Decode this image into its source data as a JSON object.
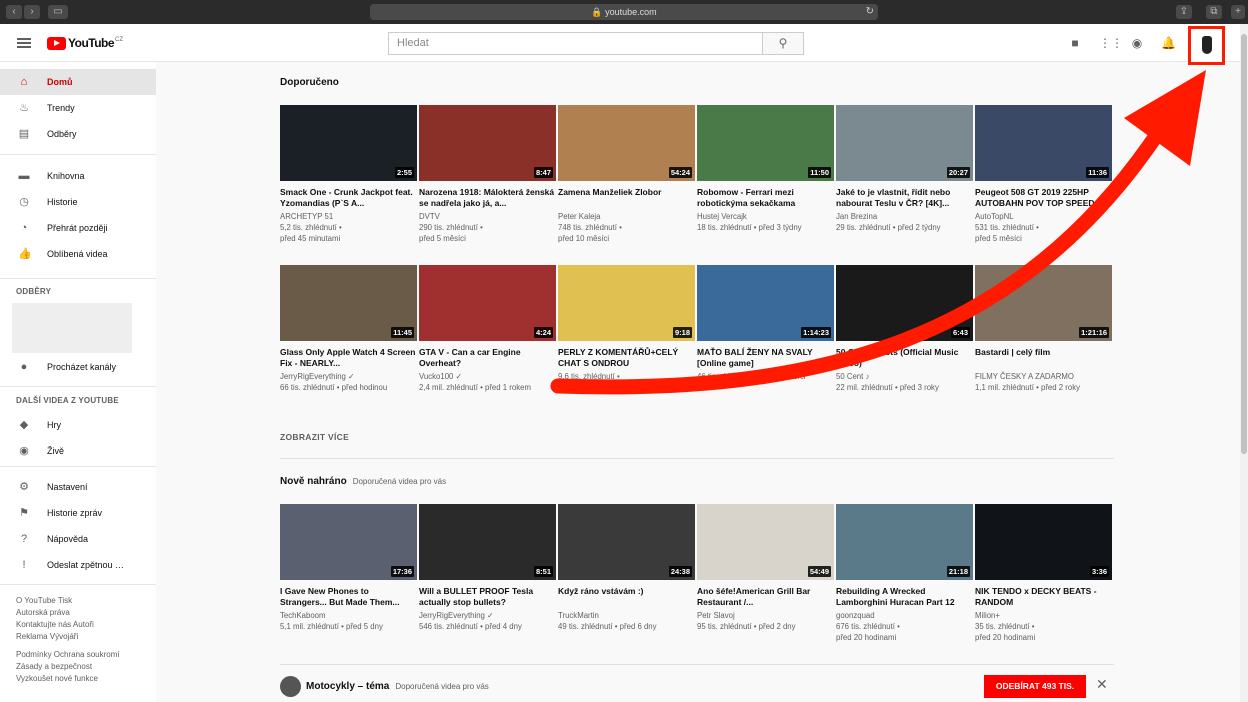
{
  "browser": {
    "url": "youtube.com"
  },
  "header": {
    "logo_text": "YouTube",
    "logo_region": "CZ",
    "search_placeholder": "Hledat"
  },
  "sidebar": {
    "main": [
      {
        "label": "Domů",
        "icon": "home-icon",
        "glyph": "⌂",
        "active": true
      },
      {
        "label": "Trendy",
        "icon": "flame-icon",
        "glyph": "♨"
      },
      {
        "label": "Odběry",
        "icon": "subscriptions-icon",
        "glyph": "▤"
      }
    ],
    "library": [
      {
        "label": "Knihovna",
        "icon": "folder-icon",
        "glyph": "▬"
      },
      {
        "label": "Historie",
        "icon": "history-icon",
        "glyph": "◷"
      },
      {
        "label": "Přehrát později",
        "icon": "clock-icon",
        "glyph": "◔"
      },
      {
        "label": "Oblíbená videa",
        "icon": "thumbs-up-icon",
        "glyph": "👍"
      }
    ],
    "subs_heading": "ODBĚRY",
    "browse_channels": "Procházet kanály",
    "more_heading": "DALŠÍ VIDEA Z YOUTUBE",
    "more": [
      {
        "label": "Hry",
        "icon": "gamepad-icon",
        "glyph": "◆"
      },
      {
        "label": "Živě",
        "icon": "live-icon",
        "glyph": "◉"
      }
    ],
    "settings": [
      {
        "label": "Nastavení",
        "icon": "gear-icon",
        "glyph": "⚙"
      },
      {
        "label": "Historie zpráv",
        "icon": "flag-icon",
        "glyph": "⚑"
      },
      {
        "label": "Nápověda",
        "icon": "help-icon",
        "glyph": "?"
      },
      {
        "label": "Odeslat zpětnou …",
        "icon": "feedback-icon",
        "glyph": "!"
      }
    ],
    "footer1": [
      "O YouTube  Tisk",
      "Autorská práva",
      "Kontaktujte nás  Autoři",
      "Reklama  Vývojáři"
    ],
    "footer2": [
      "Podmínky  Ochrana soukromí",
      "Zásady a bezpečnost",
      "Vyzkoušet nové funkce"
    ]
  },
  "sections": {
    "recommended_title": "Doporučeno",
    "show_more": "ZOBRAZIT VÍCE",
    "new_title": "Nově nahráno",
    "new_sub": "Doporučená videa pro vás",
    "moto_title": "Motocykly – téma",
    "moto_sub": "Doporučená videa pro vás",
    "subscribe_label": "ODEBÍRAT  493 TIS."
  },
  "row1": [
    {
      "title": "Smack One - Crunk Jackpot feat. Yzomandias (P`S A...",
      "channel": "ARCHETYP 51",
      "views": "5,2 tis. zhlédnutí •",
      "age": "před 45 minutami",
      "duration": "2:55",
      "color": "#1a2026"
    },
    {
      "title": "Narozena 1918: Málokterá ženská se nadřela jako já, a...",
      "channel": "DVTV",
      "views": "290 tis. zhlédnutí •",
      "age": "před 5 měsíci",
      "duration": "8:47",
      "color": "#8a3028"
    },
    {
      "title": "Zamena Manželiek Zlobor",
      "channel": "Peter Kaleja",
      "views": "748 tis. zhlédnutí •",
      "age": "před 10 měsíci",
      "duration": "54:24",
      "color": "#b08050"
    },
    {
      "title": "Robomow - Ferrari mezi robotickýma sekačkama",
      "channel": "Hustej Vercajk",
      "views": "18 tis. zhlédnutí • před 3 týdny",
      "age": "",
      "duration": "11:50",
      "color": "#4a7a48"
    },
    {
      "title": "Jaké to je vlastnit, řídit nebo nabourat Teslu v ČR? [4K]...",
      "channel": "Jan Brezina",
      "views": "29 tis. zhlédnutí • před 2 týdny",
      "age": "",
      "duration": "20:27",
      "color": "#7a8a90"
    },
    {
      "title": "Peugeot 508 GT 2019 225HP AUTOBAHN POV TOP SPEED",
      "channel": "AutoTopNL",
      "views": "531 tis. zhlédnutí •",
      "age": "před 5 měsíci",
      "duration": "11:36",
      "color": "#3a4a66"
    }
  ],
  "row2": [
    {
      "title": "Glass Only Apple Watch 4 Screen Fix - NEARLY...",
      "channel": "JerryRigEverything ✓",
      "views": "66 tis. zhlédnutí • před hodinou",
      "age": "",
      "duration": "11:45",
      "color": "#6a5a48"
    },
    {
      "title": "GTA V - Can a car Engine Overheat?",
      "channel": "Vucko100 ✓",
      "views": "2,4 mil. zhlédnutí • před 1 rokem",
      "age": "",
      "duration": "4:24",
      "color": "#a03030"
    },
    {
      "title": "PERLY Z KOMENTÁŘŮ+CELÝ CHAT S ONDROU",
      "channel": "",
      "views": "9,6 tis. zhlédnutí •",
      "age": "před 6 hodinami",
      "duration": "9:18",
      "color": "#e0c050"
    },
    {
      "title": "MAŤO BALÍ ŽENY NA SVALY [Online game]",
      "channel": "",
      "views": "46 tis. zhlédnutí • před 3 měsíci",
      "age": "",
      "duration": "1:14:23",
      "color": "#3a6a9a"
    },
    {
      "title": "50 Cent - Shots (Official Music Video)",
      "channel": "50 Cent ♪",
      "views": "22 mil. zhlédnutí • před 3 roky",
      "age": "",
      "duration": "6:43",
      "color": "#1a1a1a"
    },
    {
      "title": "Bastardi | celý film",
      "channel": "FILMY ČESKY A ZADARMO",
      "views": "1,1 mil. zhlédnutí • před 2 roky",
      "age": "",
      "duration": "1:21:16",
      "color": "#807060"
    }
  ],
  "row3": [
    {
      "title": "I Gave New Phones to Strangers... But Made Them...",
      "channel": "TechKaboom",
      "views": "5,1 mil. zhlédnutí • před 5 dny",
      "age": "",
      "duration": "17:36",
      "color": "#5a6070"
    },
    {
      "title": "Will a BULLET PROOF Tesla actually stop bullets?",
      "channel": "JerryRigEverything ✓",
      "views": "546 tis. zhlédnutí • před 4 dny",
      "age": "",
      "duration": "8:51",
      "color": "#2a2a2a"
    },
    {
      "title": "Když ráno vstávám :)",
      "channel": "TruckMartin",
      "views": "49 tis. zhlédnutí • před 6 dny",
      "age": "",
      "duration": "24:38",
      "color": "#3a3a3a"
    },
    {
      "title": "Ano šéfe!American Grill Bar Restaurant /...",
      "channel": "Petr Slavoj",
      "views": "95 tis. zhlédnutí • před 2 dny",
      "age": "",
      "duration": "54:49",
      "color": "#d8d4cc"
    },
    {
      "title": "Rebuilding A Wrecked Lamborghini Huracan Part 12",
      "channel": "goonzquad",
      "views": "676 tis. zhlédnutí •",
      "age": "před 20 hodinami",
      "duration": "21:18",
      "color": "#5a7a8a"
    },
    {
      "title": "NIK TENDO x DECKY BEATS - RANDOM",
      "channel": "Milion+",
      "views": "35 tis. zhlédnutí •",
      "age": "před 20 hodinami",
      "duration": "3:36",
      "color": "#101418"
    }
  ],
  "annotation_color": "#ff1a00"
}
